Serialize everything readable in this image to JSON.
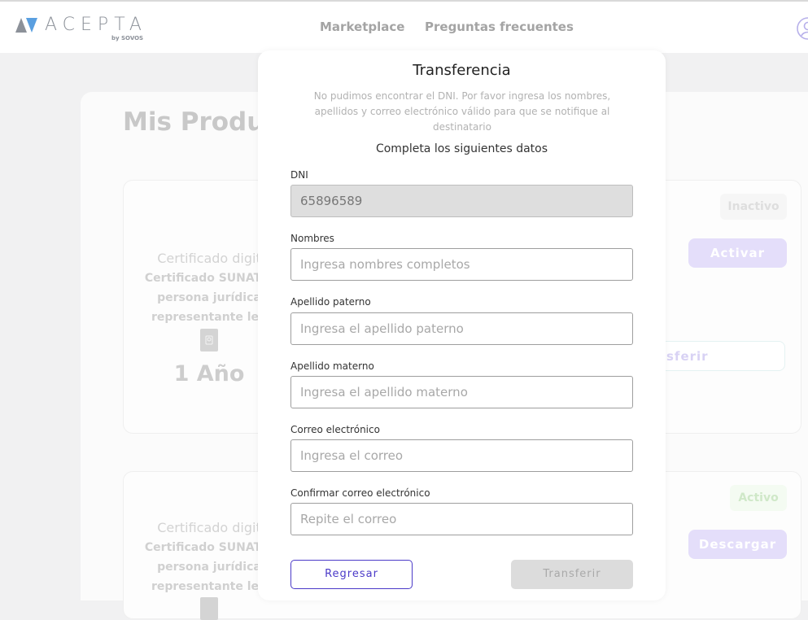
{
  "header": {
    "logo_text": "ACEPTA",
    "logo_sub": "by SOVOS",
    "nav": [
      {
        "label": "Marketplace"
      },
      {
        "label": "Preguntas frecuentes"
      }
    ]
  },
  "page": {
    "title": "Mis Produc",
    "products": [
      {
        "type": "Certificado digit",
        "name_lines": [
          "Certificado SUNAT p",
          "persona jurídica",
          "representante leg"
        ],
        "duration": "1 Año",
        "status": "Inactivo",
        "primary_action": "Activar",
        "secondary_action": "sferir"
      },
      {
        "type": "Certificado digit",
        "name_lines": [
          "Certificado SUNAT p",
          "persona jurídica",
          "representante leg"
        ],
        "status": "Activo",
        "primary_action": "Descargar"
      }
    ]
  },
  "modal": {
    "title": "Transferencia",
    "description": "No pudimos encontrar el DNI. Por favor ingresa los nombres, apellidos y correo electrónico válido para que se notifique al destinatario",
    "subtitle": "Completa los siguientes datos",
    "fields": [
      {
        "label": "DNI",
        "value": "65896589",
        "placeholder": "",
        "disabled": true
      },
      {
        "label": "Nombres",
        "value": "",
        "placeholder": "Ingresa nombres completos"
      },
      {
        "label": "Apellido paterno",
        "value": "",
        "placeholder": "Ingresa el apellido paterno"
      },
      {
        "label": "Apellido materno",
        "value": "",
        "placeholder": "Ingresa el apellido materno"
      },
      {
        "label": "Correo electrónico",
        "value": "",
        "placeholder": "Ingresa el correo"
      },
      {
        "label": "Confirmar correo electrónico",
        "value": "",
        "placeholder": "Repite el correo"
      }
    ],
    "back_label": "Regresar",
    "transfer_label": "Transferir"
  },
  "colors": {
    "accent": "#4b3ac8",
    "disabled_button": "#dcdcdc",
    "faded_purple": "#e4defa",
    "active_badge": "#c9e8c2"
  },
  "icons": {
    "logo": "acepta-triangles-icon",
    "user": "user-account-icon",
    "certificate": "certificate-icon"
  }
}
